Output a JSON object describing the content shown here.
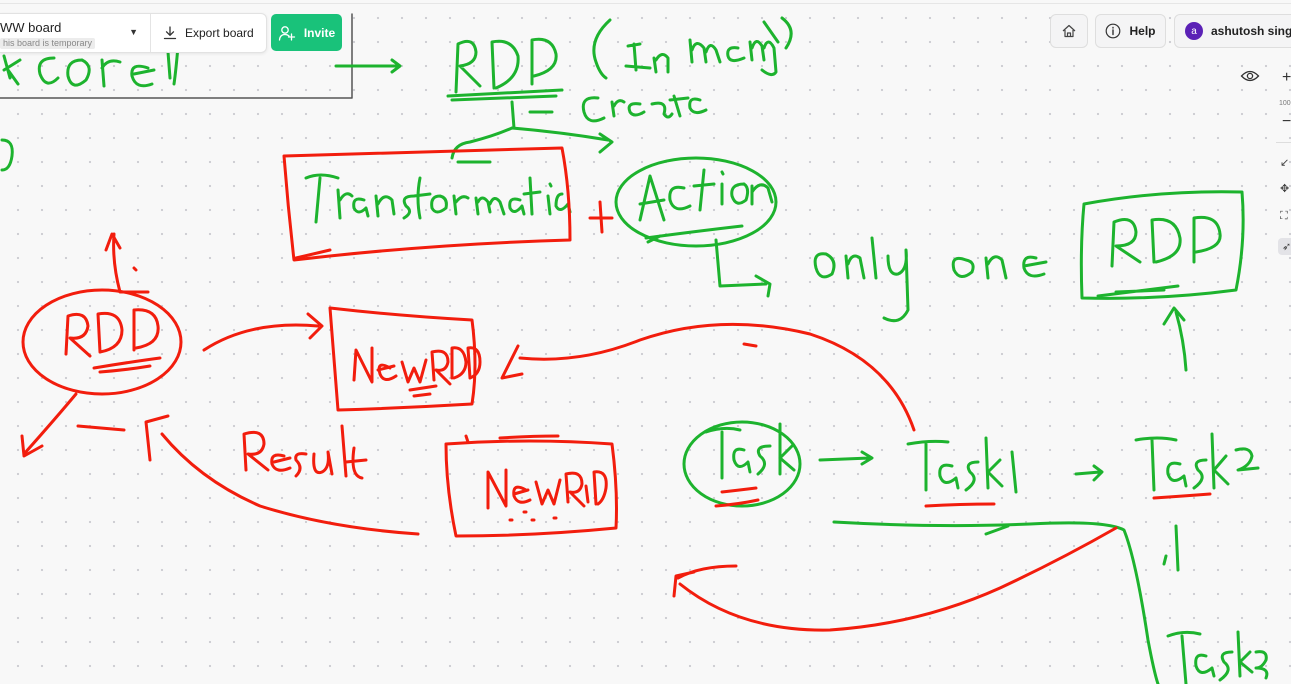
{
  "board": {
    "name": "WW board",
    "temporary_label": "his board is temporary"
  },
  "toolbar": {
    "export_label": "Export board",
    "invite_label": "Invite",
    "help_label": "Help",
    "user_name": "ashutosh singh",
    "user_initial": "a",
    "zoom_level": "100"
  },
  "colors": {
    "invite": "#19c27a",
    "avatar": "#5b21b6",
    "ink_green": "#1db32e",
    "ink_red": "#f21d0d"
  },
  "icons": [
    "chevron-down-icon",
    "download-icon",
    "add-user-icon",
    "home-icon",
    "info-icon",
    "eye-icon",
    "zoom-in-icon",
    "zoom-out-icon",
    "fit-icon",
    "move-icon",
    "expand-icon",
    "laser-icon"
  ]
}
